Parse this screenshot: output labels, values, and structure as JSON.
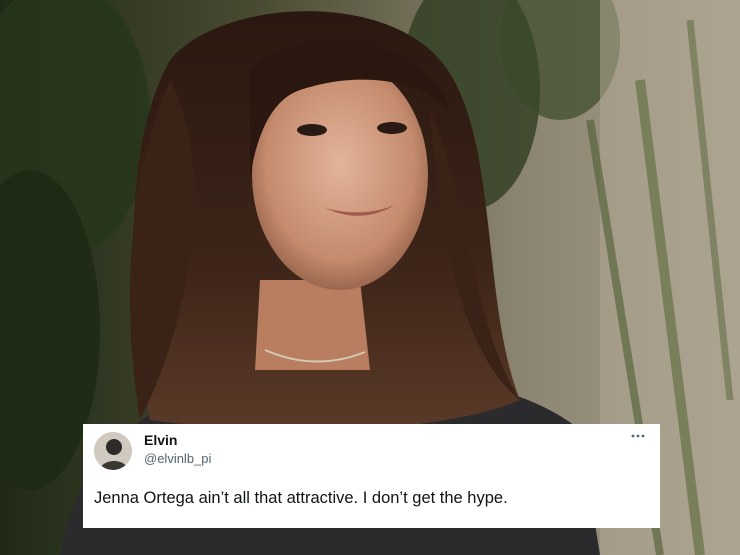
{
  "tweet": {
    "display_name": "Elvin",
    "handle": "@elvinlb_pi",
    "text": "Jenna Ortega ain’t all that attractive. I don’t get the hype.",
    "more_icon": "more-horizontal-icon"
  },
  "colors": {
    "card_background": "#ffffff",
    "name_text": "#0f1419",
    "handle_text": "#536471"
  }
}
